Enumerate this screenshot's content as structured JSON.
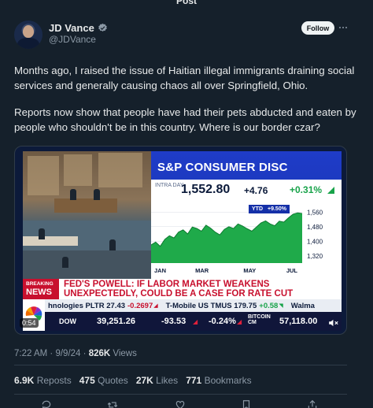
{
  "page": {
    "top_label": "Post"
  },
  "author": {
    "name": "JD Vance",
    "handle": "@JDVance",
    "follow_label": "Follow"
  },
  "tweet": {
    "paragraphs": [
      "Months ago, I raised the issue of Haitian illegal immigrants draining social services and generally causing chaos all over Springfield, Ohio.",
      "Reports now show that people have had their pets abducted and eaten by people who shouldn't be in this country. Where is our border czar?"
    ]
  },
  "media": {
    "graphic_title": "S&P CONSUMER DISC",
    "intraday_label": "INTRA DAY",
    "price": "1,552.80",
    "change": "+4.76",
    "pct": "+0.31%",
    "ytd_label": "YTD",
    "ytd_value": "+9.50%",
    "breaking_line1": "BREAKING",
    "breaking_line2": "NEWS",
    "headline": "FED'S POWELL: IF LABOR MARKET WEAKENS UNEXPECTEDLY, COULD BE A CASE FOR RATE CUT",
    "ticker1": {
      "a": "hnologies PLTR 27.43",
      "a_chg": "-0.2697",
      "b": "T-Mobile US TMUS 179.75",
      "b_chg": "+0.58",
      "c": "Walma"
    },
    "ticker2": {
      "dow_label": "DOW",
      "dow_value": "39,251.26",
      "dow_change": "-93.53",
      "dow_pct": "-0.24%",
      "bitcoin_label_1": "BITCOIN",
      "bitcoin_label_2": "CM",
      "bitcoin_value": "57,118.00"
    },
    "video_time": "0:54",
    "colors": {
      "cnbc_blue": "#1f3cc8",
      "breaking_red": "#c8102e",
      "up_green": "#18a34a"
    }
  },
  "chart_data": {
    "type": "area",
    "x": [
      "JAN",
      "MAR",
      "MAY",
      "JUL"
    ],
    "ylim": [
      1280,
      1600
    ],
    "yticks": [
      "1,560",
      "1,480",
      "1,400",
      "1,320"
    ],
    "values": [
      1380,
      1395,
      1372,
      1410,
      1430,
      1418,
      1450,
      1462,
      1440,
      1478,
      1470,
      1455,
      1488,
      1472,
      1450,
      1435,
      1465,
      1480,
      1470,
      1495,
      1483,
      1468,
      1455,
      1478,
      1500,
      1512,
      1495,
      1485,
      1510,
      1505,
      1528,
      1548,
      1556,
      1552
    ],
    "grid": true,
    "legend": "none"
  },
  "meta": {
    "time": "7:22 AM",
    "date": "9/9/24",
    "views_count": "826K",
    "views_label": "Views"
  },
  "stats": {
    "reposts_count": "6.9K",
    "reposts_label": "Reposts",
    "quotes_count": "475",
    "quotes_label": "Quotes",
    "likes_count": "27K",
    "likes_label": "Likes",
    "bookmarks_count": "771",
    "bookmarks_label": "Bookmarks"
  }
}
